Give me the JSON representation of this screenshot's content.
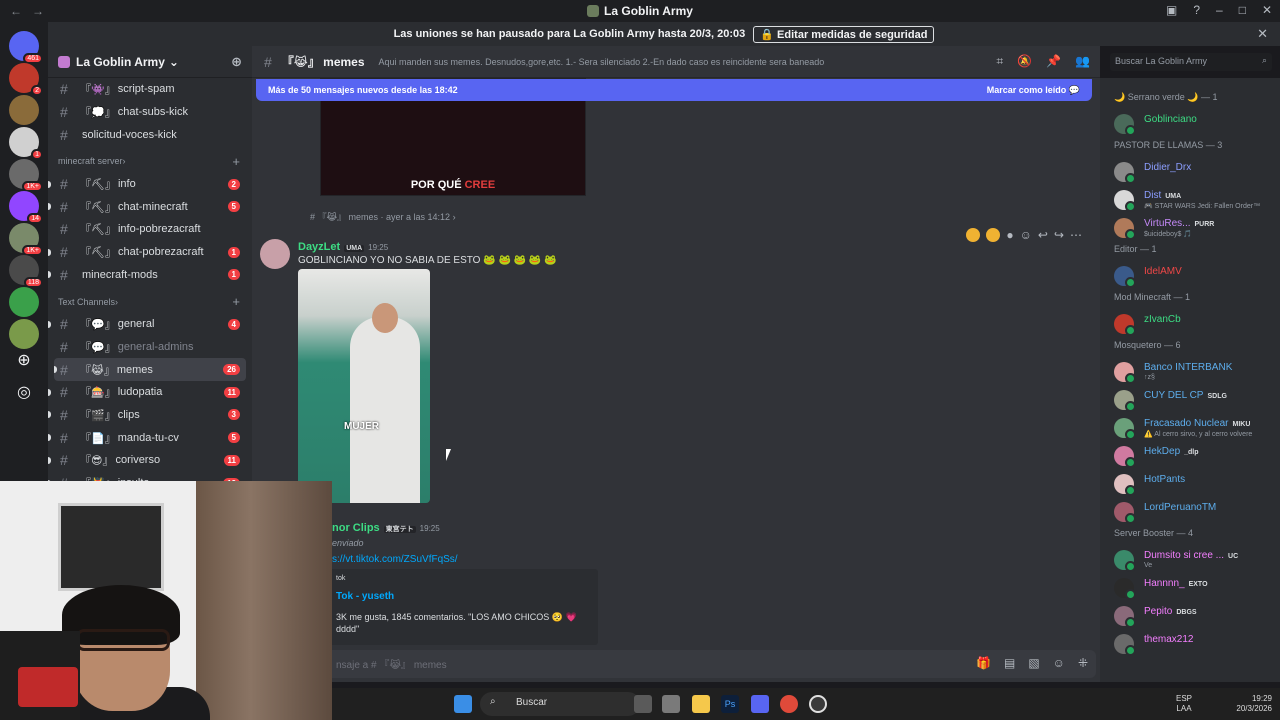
{
  "window": {
    "title": "La Goblin Army"
  },
  "banner": {
    "text": "Las uniones se han pausado para La Goblin Army hasta 20/3, 20:03",
    "button": "Editar medidas de seguridad"
  },
  "server_rail": [
    {
      "badge": "461",
      "color": "#5865f2"
    },
    {
      "badge": "2",
      "color": "#c0392b"
    },
    {
      "badge": "",
      "color": "#8a6b3a"
    },
    {
      "badge": "1",
      "color": "#d0d0d0"
    },
    {
      "badge": "1K+",
      "color": "#6a6a6a"
    },
    {
      "badge": "14",
      "color": "#9146ff"
    },
    {
      "badge": "1K+",
      "color": "#7a8a6a"
    },
    {
      "badge": "118",
      "color": "#4a4a4a"
    },
    {
      "badge": "",
      "color": "#3aa04a"
    },
    {
      "badge": "",
      "color": "#7a9a4a"
    }
  ],
  "guild": {
    "name": "La Goblin Army"
  },
  "channels_top": [
    {
      "name": "script-spam",
      "prefix": "『👾』",
      "count": ""
    },
    {
      "name": "chat-subs-kick",
      "prefix": "『💭』",
      "count": ""
    },
    {
      "name": "solicitud-voces-kick",
      "prefix": "",
      "count": ""
    }
  ],
  "cat_minecraft": "minecraft server",
  "channels_mc": [
    {
      "name": "info",
      "prefix": "『⛏』",
      "count": "2"
    },
    {
      "name": "chat-minecraft",
      "prefix": "『⛏』",
      "count": "5"
    },
    {
      "name": "info-pobrezacraft",
      "prefix": "『⛏』",
      "count": ""
    },
    {
      "name": "chat-pobrezacraft",
      "prefix": "『⛏』",
      "count": "1"
    },
    {
      "name": "minecraft-mods",
      "prefix": "",
      "count": "1"
    }
  ],
  "cat_text": "Text Channels",
  "channels_text": [
    {
      "name": "general",
      "prefix": "『💬』",
      "count": "4"
    },
    {
      "name": "general-admins",
      "prefix": "『💬』",
      "count": ""
    },
    {
      "name": "memes",
      "prefix": "『😹』",
      "count": "26"
    },
    {
      "name": "ludopatia",
      "prefix": "『🎰』",
      "count": "11"
    },
    {
      "name": "clips",
      "prefix": "『🎬』",
      "count": "3"
    },
    {
      "name": "manda-tu-cv",
      "prefix": "『📄』",
      "count": "5"
    },
    {
      "name": "coriverso",
      "prefix": "『😎』",
      "count": "11"
    },
    {
      "name": "insulta",
      "prefix": "『👹』",
      "count": "12"
    }
  ],
  "header": {
    "channel": "『😹』 memes",
    "topic": "Aqui manden sus memes. Desnudos,gore,etc. 1.- Sera silenciado 2.-En dado caso es reincidente sera baneado",
    "search_placeholder": "Buscar La Goblin Army"
  },
  "newbar": {
    "text": "Más de 50 mensajes nuevos desde las 18:42",
    "action": "Marcar como leído"
  },
  "top_image_caption": {
    "a": "POR QUÉ ",
    "b": "CREE"
  },
  "forward_line": "# 『😹』 memes · ayer a las 14:12 ›",
  "msg1": {
    "user": "DayzLet",
    "tag": "UMA",
    "time": "19:25",
    "text": "GOBLINCIANO YO NO SABIA DE ESTO 🐸 🐸 🐸 🐸 🐸",
    "video_caption": "MUJER"
  },
  "msg2": {
    "user": "Minor Clips",
    "user_visible": "nor Clips",
    "tag": "東宮テト",
    "time": "19:25",
    "forwarded": "enviado",
    "link": "s://vt.tiktok.com/ZSuVfFqSs/",
    "embed_provider": "tok",
    "embed_title": "Tok - yuseth",
    "embed_desc": "3K me gusta, 1845 comentarios. \"LOS AMO CHICOS 🥺 💗",
    "embed_desc2": "dddd\""
  },
  "composer": {
    "placeholder": "nsaje a # 『😹』 memes"
  },
  "members": [
    {
      "type": "cat",
      "text": "🌙 Serrano verde 🌙 — 1"
    },
    {
      "type": "mem",
      "name": "Goblinciano",
      "color": "#3ddc84",
      "tag": "",
      "sub": "",
      "av": "#4a6a5a"
    },
    {
      "type": "cat",
      "text": "PASTOR DE LLAMAS — 3"
    },
    {
      "type": "mem",
      "name": "Didier_Drx",
      "color": "#8c9eff",
      "tag": "",
      "sub": "",
      "av": "#8a8a8a"
    },
    {
      "type": "mem",
      "name": "Dist",
      "color": "#8c9eff",
      "tag": "UMA",
      "sub": "🎮 STAR WARS Jedi: Fallen Order™",
      "av": "#d8d8d8"
    },
    {
      "type": "mem",
      "name": "VirtuRes...",
      "color": "#c58af9",
      "tag": "PURR",
      "sub": "$uicideboy$ 🎵",
      "av": "#b07a5a"
    },
    {
      "type": "cat",
      "text": "Editor — 1"
    },
    {
      "type": "mem",
      "name": "IdelAMV",
      "color": "#f04747",
      "tag": "",
      "sub": "",
      "av": "#3a5a8a"
    },
    {
      "type": "cat",
      "text": "Mod Minecraft — 1"
    },
    {
      "type": "mem",
      "name": "zIvanCb",
      "color": "#3ddc84",
      "tag": "",
      "sub": "",
      "av": "#c0392b"
    },
    {
      "type": "cat",
      "text": "Mosquetero — 6"
    },
    {
      "type": "mem",
      "name": "Banco INTERBANK",
      "color": "#5dadec",
      "tag": "",
      "sub": "↑z§",
      "av": "#e0a0a0"
    },
    {
      "type": "mem",
      "name": "CUY DEL CP",
      "color": "#5dadec",
      "tag": "SDLG",
      "sub": "",
      "av": "#9aa08a"
    },
    {
      "type": "mem",
      "name": "Fracasado Nuclear",
      "color": "#5dadec",
      "tag": "MIKU",
      "sub": "⚠️ Al cerro sirvo, y al cerro volvere",
      "av": "#6aa07a"
    },
    {
      "type": "mem",
      "name": "HekDep",
      "color": "#5dadec",
      "tag": "_dlp",
      "sub": "",
      "av": "#d07aa0"
    },
    {
      "type": "mem",
      "name": "HotPants",
      "color": "#5dadec",
      "tag": "",
      "sub": "",
      "av": "#e0c0c0"
    },
    {
      "type": "mem",
      "name": "LordPeruanoTM",
      "color": "#5dadec",
      "tag": "",
      "sub": "",
      "av": "#a05a6a"
    },
    {
      "type": "cat",
      "text": "Server Booster — 4"
    },
    {
      "type": "mem",
      "name": "Dumsito si cree ...",
      "color": "#f47fff",
      "tag": "UC",
      "sub": "Ve",
      "av": "#3a8a6a"
    },
    {
      "type": "mem",
      "name": "Hannnn_",
      "color": "#f47fff",
      "tag": "EXTO",
      "sub": "",
      "av": "#2a2a2a"
    },
    {
      "type": "mem",
      "name": "Pepito",
      "color": "#f47fff",
      "tag": "DBGS",
      "sub": "",
      "av": "#8a6a7a"
    },
    {
      "type": "mem",
      "name": "themax212",
      "color": "#f47fff",
      "tag": "",
      "sub": "",
      "av": "#6a6a6a"
    }
  ],
  "taskbar": {
    "search": "Buscar",
    "lang1": "ESP",
    "lang2": "LAA",
    "time": "19:29",
    "date": "20/3/2026"
  }
}
